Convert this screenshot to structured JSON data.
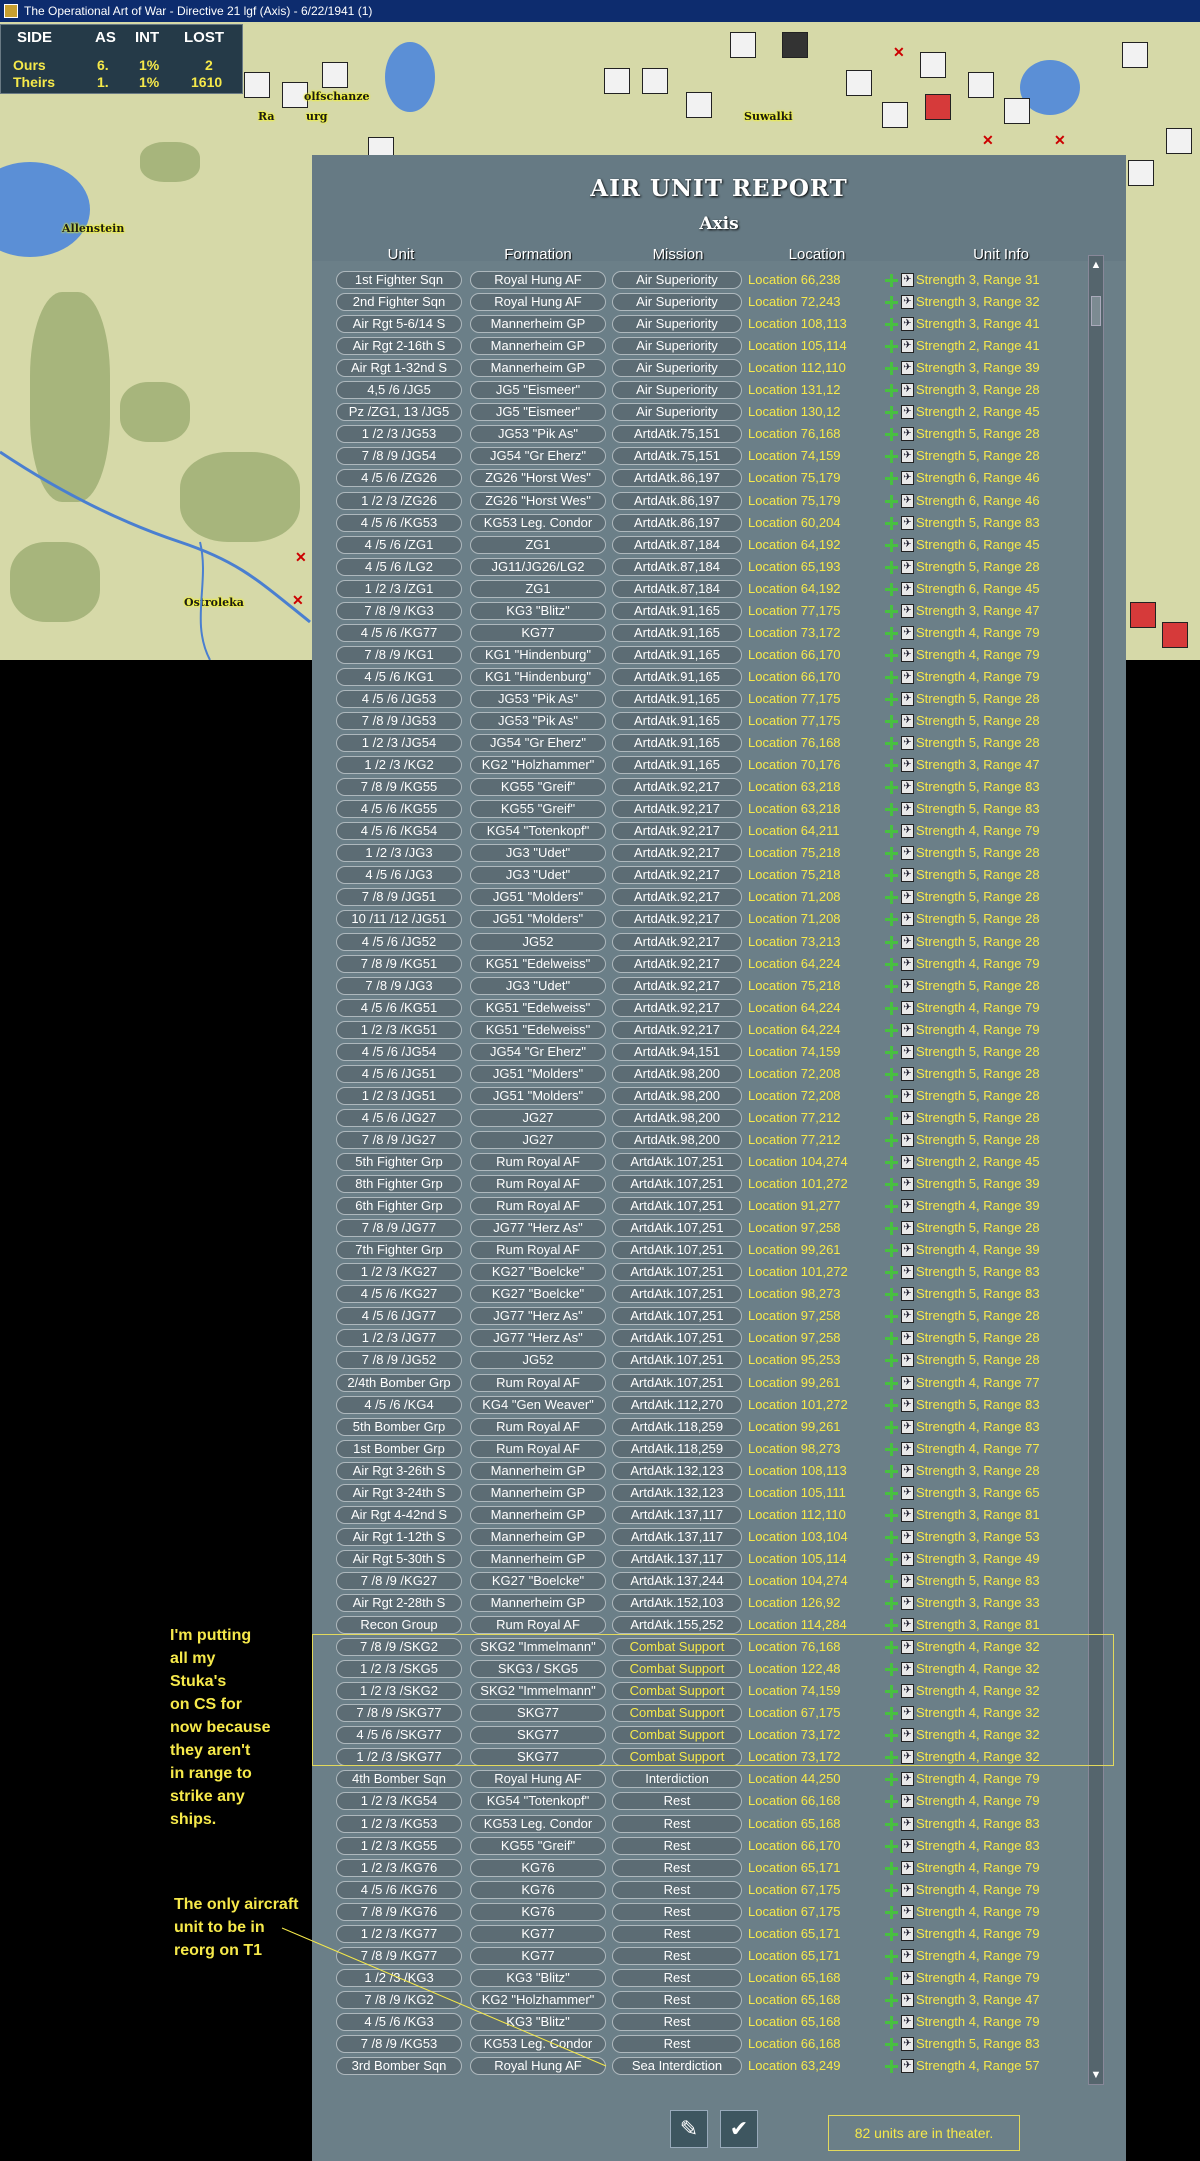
{
  "window": {
    "title": "The Operational Art of War - Directive 21 lgf (Axis) - 6/22/1941 (1)"
  },
  "side_table": {
    "headers": [
      "SIDE",
      "AS",
      "INT",
      "LOST"
    ],
    "rows": [
      {
        "side": "Ours",
        "as": "6.",
        "int": "1%",
        "lost": "2"
      },
      {
        "side": "Theirs",
        "as": "1.",
        "int": "1%",
        "lost": "1610"
      }
    ]
  },
  "map_labels": [
    "Allenstein",
    "Ostroleka",
    "Suwalki",
    "olfschanze",
    "Ra",
    "urg"
  ],
  "report": {
    "title": "AIR UNIT REPORT",
    "subtitle": "Axis",
    "columns": [
      "Unit",
      "Formation",
      "Mission",
      "Location",
      "Unit Info"
    ],
    "rows": [
      {
        "unit": "1st Fighter Sqn",
        "formation": "Royal Hung AF",
        "mission": "Air Superiority",
        "location": "Location 66,238",
        "info": "Strength 3, Range 31"
      },
      {
        "unit": "2nd Fighter Sqn",
        "formation": "Royal Hung AF",
        "mission": "Air Superiority",
        "location": "Location 72,243",
        "info": "Strength 3, Range 32"
      },
      {
        "unit": "Air Rgt 5-6/14 S",
        "formation": "Mannerheim GP",
        "mission": "Air Superiority",
        "location": "Location 108,113",
        "info": "Strength 3, Range 41"
      },
      {
        "unit": "Air Rgt 2-16th S",
        "formation": "Mannerheim GP",
        "mission": "Air Superiority",
        "location": "Location 105,114",
        "info": "Strength 2, Range 41"
      },
      {
        "unit": "Air Rgt 1-32nd S",
        "formation": "Mannerheim GP",
        "mission": "Air Superiority",
        "location": "Location 112,110",
        "info": "Strength 3, Range 39"
      },
      {
        "unit": "4,5 /6 /JG5",
        "formation": "JG5 \"Eismeer\"",
        "mission": "Air Superiority",
        "location": "Location 131,12",
        "info": "Strength 3, Range 28"
      },
      {
        "unit": "Pz /ZG1, 13 /JG5",
        "formation": "JG5 \"Eismeer\"",
        "mission": "Air Superiority",
        "location": "Location 130,12",
        "info": "Strength 2, Range 45"
      },
      {
        "unit": "1 /2 /3 /JG53",
        "formation": "JG53 \"Pik As\"",
        "mission": "ArtdAtk.75,151",
        "location": "Location 76,168",
        "info": "Strength 5, Range 28"
      },
      {
        "unit": "7 /8 /9 /JG54",
        "formation": "JG54 \"Gr Eherz\"",
        "mission": "ArtdAtk.75,151",
        "location": "Location 74,159",
        "info": "Strength 5, Range 28"
      },
      {
        "unit": "4 /5 /6 /ZG26",
        "formation": "ZG26 \"Horst Wes\"",
        "mission": "ArtdAtk.86,197",
        "location": "Location 75,179",
        "info": "Strength 6, Range 46"
      },
      {
        "unit": "1 /2 /3 /ZG26",
        "formation": "ZG26 \"Horst Wes\"",
        "mission": "ArtdAtk.86,197",
        "location": "Location 75,179",
        "info": "Strength 6, Range 46"
      },
      {
        "unit": "4 /5 /6 /KG53",
        "formation": "KG53 Leg. Condor",
        "mission": "ArtdAtk.86,197",
        "location": "Location 60,204",
        "info": "Strength 5, Range 83"
      },
      {
        "unit": "4 /5 /6 /ZG1",
        "formation": "ZG1",
        "mission": "ArtdAtk.87,184",
        "location": "Location 64,192",
        "info": "Strength 6, Range 45"
      },
      {
        "unit": "4 /5 /6 /LG2",
        "formation": "JG11/JG26/LG2",
        "mission": "ArtdAtk.87,184",
        "location": "Location 65,193",
        "info": "Strength 5, Range 28"
      },
      {
        "unit": "1 /2 /3 /ZG1",
        "formation": "ZG1",
        "mission": "ArtdAtk.87,184",
        "location": "Location 64,192",
        "info": "Strength 6, Range 45"
      },
      {
        "unit": "7 /8 /9 /KG3",
        "formation": "KG3 \"Blitz\"",
        "mission": "ArtdAtk.91,165",
        "location": "Location 77,175",
        "info": "Strength 3, Range 47"
      },
      {
        "unit": "4 /5 /6 /KG77",
        "formation": "KG77",
        "mission": "ArtdAtk.91,165",
        "location": "Location 73,172",
        "info": "Strength 4, Range 79"
      },
      {
        "unit": "7 /8 /9 /KG1",
        "formation": "KG1 \"Hindenburg\"",
        "mission": "ArtdAtk.91,165",
        "location": "Location 66,170",
        "info": "Strength 4, Range 79"
      },
      {
        "unit": "4 /5 /6 /KG1",
        "formation": "KG1 \"Hindenburg\"",
        "mission": "ArtdAtk.91,165",
        "location": "Location 66,170",
        "info": "Strength 4, Range 79"
      },
      {
        "unit": "4 /5 /6 /JG53",
        "formation": "JG53 \"Pik As\"",
        "mission": "ArtdAtk.91,165",
        "location": "Location 77,175",
        "info": "Strength 5, Range 28"
      },
      {
        "unit": "7 /8 /9 /JG53",
        "formation": "JG53 \"Pik As\"",
        "mission": "ArtdAtk.91,165",
        "location": "Location 77,175",
        "info": "Strength 5, Range 28"
      },
      {
        "unit": "1 /2 /3 /JG54",
        "formation": "JG54 \"Gr Eherz\"",
        "mission": "ArtdAtk.91,165",
        "location": "Location 76,168",
        "info": "Strength 5, Range 28"
      },
      {
        "unit": "1 /2 /3 /KG2",
        "formation": "KG2 \"Holzhammer\"",
        "mission": "ArtdAtk.91,165",
        "location": "Location 70,176",
        "info": "Strength 3, Range 47"
      },
      {
        "unit": "7 /8 /9 /KG55",
        "formation": "KG55 \"Greif\"",
        "mission": "ArtdAtk.92,217",
        "location": "Location 63,218",
        "info": "Strength 5, Range 83"
      },
      {
        "unit": "4 /5 /6 /KG55",
        "formation": "KG55 \"Greif\"",
        "mission": "ArtdAtk.92,217",
        "location": "Location 63,218",
        "info": "Strength 5, Range 83"
      },
      {
        "unit": "4 /5 /6 /KG54",
        "formation": "KG54 \"Totenkopf\"",
        "mission": "ArtdAtk.92,217",
        "location": "Location 64,211",
        "info": "Strength 4, Range 79"
      },
      {
        "unit": "1 /2 /3 /JG3",
        "formation": "JG3 \"Udet\"",
        "mission": "ArtdAtk.92,217",
        "location": "Location 75,218",
        "info": "Strength 5, Range 28"
      },
      {
        "unit": "4 /5 /6 /JG3",
        "formation": "JG3 \"Udet\"",
        "mission": "ArtdAtk.92,217",
        "location": "Location 75,218",
        "info": "Strength 5, Range 28"
      },
      {
        "unit": "7 /8 /9 /JG51",
        "formation": "JG51 \"Molders\"",
        "mission": "ArtdAtk.92,217",
        "location": "Location 71,208",
        "info": "Strength 5, Range 28"
      },
      {
        "unit": "10 /11 /12 /JG51",
        "formation": "JG51 \"Molders\"",
        "mission": "ArtdAtk.92,217",
        "location": "Location 71,208",
        "info": "Strength 5, Range 28"
      },
      {
        "unit": "4 /5 /6 /JG52",
        "formation": "JG52",
        "mission": "ArtdAtk.92,217",
        "location": "Location 73,213",
        "info": "Strength 5, Range 28"
      },
      {
        "unit": "7 /8 /9 /KG51",
        "formation": "KG51 \"Edelweiss\"",
        "mission": "ArtdAtk.92,217",
        "location": "Location 64,224",
        "info": "Strength 4, Range 79"
      },
      {
        "unit": "7 /8 /9 /JG3",
        "formation": "JG3 \"Udet\"",
        "mission": "ArtdAtk.92,217",
        "location": "Location 75,218",
        "info": "Strength 5, Range 28"
      },
      {
        "unit": "4 /5 /6 /KG51",
        "formation": "KG51 \"Edelweiss\"",
        "mission": "ArtdAtk.92,217",
        "location": "Location 64,224",
        "info": "Strength 4, Range 79"
      },
      {
        "unit": "1 /2 /3 /KG51",
        "formation": "KG51 \"Edelweiss\"",
        "mission": "ArtdAtk.92,217",
        "location": "Location 64,224",
        "info": "Strength 4, Range 79"
      },
      {
        "unit": "4 /5 /6 /JG54",
        "formation": "JG54 \"Gr Eherz\"",
        "mission": "ArtdAtk.94,151",
        "location": "Location 74,159",
        "info": "Strength 5, Range 28"
      },
      {
        "unit": "4 /5 /6 /JG51",
        "formation": "JG51 \"Molders\"",
        "mission": "ArtdAtk.98,200",
        "location": "Location 72,208",
        "info": "Strength 5, Range 28"
      },
      {
        "unit": "1 /2 /3 /JG51",
        "formation": "JG51 \"Molders\"",
        "mission": "ArtdAtk.98,200",
        "location": "Location 72,208",
        "info": "Strength 5, Range 28"
      },
      {
        "unit": "4 /5 /6 /JG27",
        "formation": "JG27",
        "mission": "ArtdAtk.98,200",
        "location": "Location 77,212",
        "info": "Strength 5, Range 28"
      },
      {
        "unit": "7 /8 /9 /JG27",
        "formation": "JG27",
        "mission": "ArtdAtk.98,200",
        "location": "Location 77,212",
        "info": "Strength 5, Range 28"
      },
      {
        "unit": "5th Fighter Grp",
        "formation": "Rum Royal AF",
        "mission": "ArtdAtk.107,251",
        "location": "Location 104,274",
        "info": "Strength 2, Range 45"
      },
      {
        "unit": "8th Fighter Grp",
        "formation": "Rum Royal AF",
        "mission": "ArtdAtk.107,251",
        "location": "Location 101,272",
        "info": "Strength 5, Range 39"
      },
      {
        "unit": "6th Fighter Grp",
        "formation": "Rum Royal AF",
        "mission": "ArtdAtk.107,251",
        "location": "Location 91,277",
        "info": "Strength 4, Range 39"
      },
      {
        "unit": "7 /8 /9 /JG77",
        "formation": "JG77 \"Herz As\"",
        "mission": "ArtdAtk.107,251",
        "location": "Location 97,258",
        "info": "Strength 5, Range 28"
      },
      {
        "unit": "7th Fighter Grp",
        "formation": "Rum Royal AF",
        "mission": "ArtdAtk.107,251",
        "location": "Location 99,261",
        "info": "Strength 4, Range 39"
      },
      {
        "unit": "1 /2 /3 /KG27",
        "formation": "KG27 \"Boelcke\"",
        "mission": "ArtdAtk.107,251",
        "location": "Location 101,272",
        "info": "Strength 5, Range 83"
      },
      {
        "unit": "4 /5 /6 /KG27",
        "formation": "KG27 \"Boelcke\"",
        "mission": "ArtdAtk.107,251",
        "location": "Location 98,273",
        "info": "Strength 5, Range 83"
      },
      {
        "unit": "4 /5 /6 /JG77",
        "formation": "JG77 \"Herz As\"",
        "mission": "ArtdAtk.107,251",
        "location": "Location 97,258",
        "info": "Strength 5, Range 28"
      },
      {
        "unit": "1 /2 /3 /JG77",
        "formation": "JG77 \"Herz As\"",
        "mission": "ArtdAtk.107,251",
        "location": "Location 97,258",
        "info": "Strength 5, Range 28"
      },
      {
        "unit": "7 /8 /9 /JG52",
        "formation": "JG52",
        "mission": "ArtdAtk.107,251",
        "location": "Location 95,253",
        "info": "Strength 5, Range 28"
      },
      {
        "unit": "2/4th Bomber Grp",
        "formation": "Rum Royal AF",
        "mission": "ArtdAtk.107,251",
        "location": "Location 99,261",
        "info": "Strength 4, Range 77"
      },
      {
        "unit": "4 /5 /6 /KG4",
        "formation": "KG4 \"Gen Weaver\"",
        "mission": "ArtdAtk.112,270",
        "location": "Location 101,272",
        "info": "Strength 5, Range 83"
      },
      {
        "unit": "5th Bomber Grp",
        "formation": "Rum Royal AF",
        "mission": "ArtdAtk.118,259",
        "location": "Location 99,261",
        "info": "Strength 4, Range 83"
      },
      {
        "unit": "1st Bomber Grp",
        "formation": "Rum Royal AF",
        "mission": "ArtdAtk.118,259",
        "location": "Location 98,273",
        "info": "Strength 4, Range 77"
      },
      {
        "unit": "Air Rgt 3-26th S",
        "formation": "Mannerheim GP",
        "mission": "ArtdAtk.132,123",
        "location": "Location 108,113",
        "info": "Strength 3, Range 28"
      },
      {
        "unit": "Air Rgt 3-24th S",
        "formation": "Mannerheim GP",
        "mission": "ArtdAtk.132,123",
        "location": "Location 105,111",
        "info": "Strength 3, Range 65"
      },
      {
        "unit": "Air Rgt 4-42nd S",
        "formation": "Mannerheim GP",
        "mission": "ArtdAtk.137,117",
        "location": "Location 112,110",
        "info": "Strength 3, Range 81"
      },
      {
        "unit": "Air Rgt 1-12th S",
        "formation": "Mannerheim GP",
        "mission": "ArtdAtk.137,117",
        "location": "Location 103,104",
        "info": "Strength 3, Range 53"
      },
      {
        "unit": "Air Rgt 5-30th S",
        "formation": "Mannerheim GP",
        "mission": "ArtdAtk.137,117",
        "location": "Location 105,114",
        "info": "Strength 3, Range 49"
      },
      {
        "unit": "7 /8 /9 /KG27",
        "formation": "KG27 \"Boelcke\"",
        "mission": "ArtdAtk.137,244",
        "location": "Location 104,274",
        "info": "Strength 5, Range 83"
      },
      {
        "unit": "Air Rgt 2-28th S",
        "formation": "Mannerheim GP",
        "mission": "ArtdAtk.152,103",
        "location": "Location 126,92",
        "info": "Strength 3, Range 33"
      },
      {
        "unit": "Recon Group",
        "formation": "Rum Royal AF",
        "mission": "ArtdAtk.155,252",
        "location": "Location 114,284",
        "info": "Strength 3, Range 81"
      },
      {
        "unit": "7 /8 /9 /SKG2",
        "formation": "SKG2 \"Immelmann\"",
        "mission": "Combat Support",
        "location": "Location 76,168",
        "info": "Strength 4, Range 32",
        "hl": true
      },
      {
        "unit": "1 /2 /3 /SKG5",
        "formation": "SKG3 / SKG5",
        "mission": "Combat Support",
        "location": "Location 122,48",
        "info": "Strength 4, Range 32",
        "hl": true
      },
      {
        "unit": "1 /2 /3 /SKG2",
        "formation": "SKG2 \"Immelmann\"",
        "mission": "Combat Support",
        "location": "Location 74,159",
        "info": "Strength 4, Range 32",
        "hl": true
      },
      {
        "unit": "7 /8 /9 /SKG77",
        "formation": "SKG77",
        "mission": "Combat Support",
        "location": "Location 67,175",
        "info": "Strength 4, Range 32",
        "hl": true
      },
      {
        "unit": "4 /5 /6 /SKG77",
        "formation": "SKG77",
        "mission": "Combat Support",
        "location": "Location 73,172",
        "info": "Strength 4, Range 32",
        "hl": true
      },
      {
        "unit": "1 /2 /3 /SKG77",
        "formation": "SKG77",
        "mission": "Combat Support",
        "location": "Location 73,172",
        "info": "Strength 4, Range 32",
        "hl": true
      },
      {
        "unit": "4th Bomber Sqn",
        "formation": "Royal Hung AF",
        "mission": "Interdiction",
        "location": "Location 44,250",
        "info": "Strength 4, Range 79"
      },
      {
        "unit": "1 /2 /3 /KG54",
        "formation": "KG54 \"Totenkopf\"",
        "mission": "Rest",
        "location": "Location 66,168",
        "info": "Strength 4, Range 79"
      },
      {
        "unit": "1 /2 /3 /KG53",
        "formation": "KG53 Leg. Condor",
        "mission": "Rest",
        "location": "Location 65,168",
        "info": "Strength 4, Range 83"
      },
      {
        "unit": "1 /2 /3 /KG55",
        "formation": "KG55 \"Greif\"",
        "mission": "Rest",
        "location": "Location 66,170",
        "info": "Strength 4, Range 83"
      },
      {
        "unit": "1 /2 /3 /KG76",
        "formation": "KG76",
        "mission": "Rest",
        "location": "Location 65,171",
        "info": "Strength 4, Range 79"
      },
      {
        "unit": "4 /5 /6 /KG76",
        "formation": "KG76",
        "mission": "Rest",
        "location": "Location 67,175",
        "info": "Strength 4, Range 79"
      },
      {
        "unit": "7 /8 /9 /KG76",
        "formation": "KG76",
        "mission": "Rest",
        "location": "Location 67,175",
        "info": "Strength 4, Range 79"
      },
      {
        "unit": "1 /2 /3 /KG77",
        "formation": "KG77",
        "mission": "Rest",
        "location": "Location 65,171",
        "info": "Strength 4, Range 79"
      },
      {
        "unit": "7 /8 /9 /KG77",
        "formation": "KG77",
        "mission": "Rest",
        "location": "Location 65,171",
        "info": "Strength 4, Range 79"
      },
      {
        "unit": "1 /2 /3 /KG3",
        "formation": "KG3 \"Blitz\"",
        "mission": "Rest",
        "location": "Location 65,168",
        "info": "Strength 4, Range 79"
      },
      {
        "unit": "7 /8 /9 /KG2",
        "formation": "KG2 \"Holzhammer\"",
        "mission": "Rest",
        "location": "Location 65,168",
        "info": "Strength 3, Range 47"
      },
      {
        "unit": "4 /5 /6 /KG3",
        "formation": "KG3 \"Blitz\"",
        "mission": "Rest",
        "location": "Location 65,168",
        "info": "Strength 4, Range 79"
      },
      {
        "unit": "7 /8 /9 /KG53",
        "formation": "KG53 Leg. Condor",
        "mission": "Rest",
        "location": "Location 66,168",
        "info": "Strength 5, Range 83"
      },
      {
        "unit": "3rd Bomber Sqn",
        "formation": "Royal Hung AF",
        "mission": "Sea Interdiction",
        "location": "Location 63,249",
        "info": "Strength 4, Range 57"
      }
    ],
    "footer": "82 units are in theater."
  },
  "annotations": {
    "stukas": [
      "I'm putting",
      "all my",
      "Stuka's",
      "on CS for",
      "now because",
      "they aren't",
      "in range to",
      "strike any",
      "ships."
    ],
    "reorg": [
      "The only aircraft",
      "unit to be in",
      "reorg on T1"
    ]
  },
  "colors": {
    "accent_yellow": "#f6e94a",
    "panel": "#6b7f88",
    "titlebar": "#0d2c6e"
  }
}
